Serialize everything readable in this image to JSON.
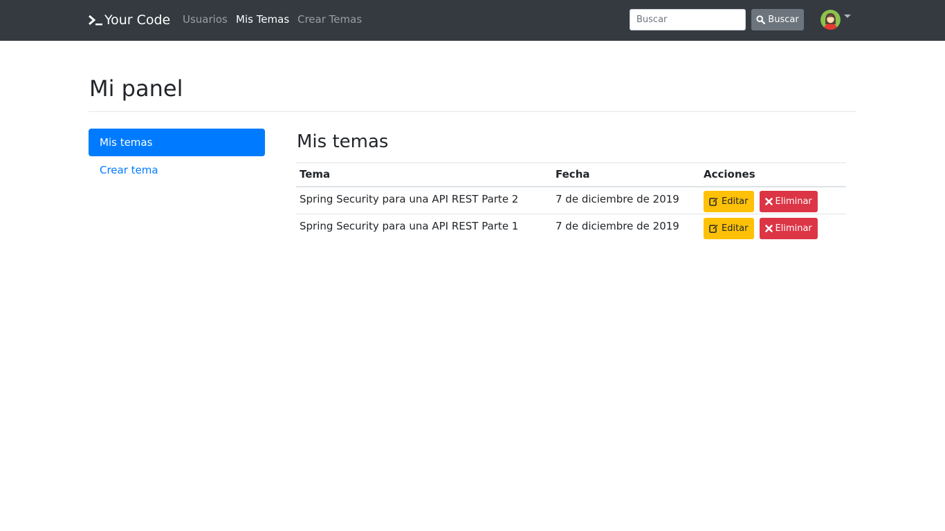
{
  "navbar": {
    "brand": "Your Code",
    "links": [
      {
        "label": "Usuarios",
        "active": false
      },
      {
        "label": "Mis Temas",
        "active": true
      },
      {
        "label": "Crear Temas",
        "active": false
      }
    ],
    "search_placeholder": "Buscar",
    "search_button": "Buscar",
    "avatar_icon": "user-avatar-icon",
    "colors": {
      "bg": "#343a40"
    }
  },
  "page": {
    "title": "Mi panel"
  },
  "sidebar": {
    "items": [
      {
        "label": "Mis temas",
        "active": true
      },
      {
        "label": "Crear tema",
        "active": false
      }
    ]
  },
  "main": {
    "title": "Mis temas",
    "table": {
      "headers": [
        "Tema",
        "Fecha",
        "Acciones"
      ],
      "rows": [
        {
          "tema": "Spring Security para una API REST Parte 2",
          "fecha": "7 de diciembre de 2019",
          "edit_label": "Editar",
          "delete_label": "Eliminar"
        },
        {
          "tema": "Spring Security para una API REST Parte 1",
          "fecha": "7 de diciembre de 2019",
          "edit_label": "Editar",
          "delete_label": "Eliminar"
        }
      ]
    }
  },
  "colors": {
    "primary": "#007bff",
    "warning": "#ffc107",
    "danger": "#dc3545",
    "secondary": "#6c757d"
  }
}
